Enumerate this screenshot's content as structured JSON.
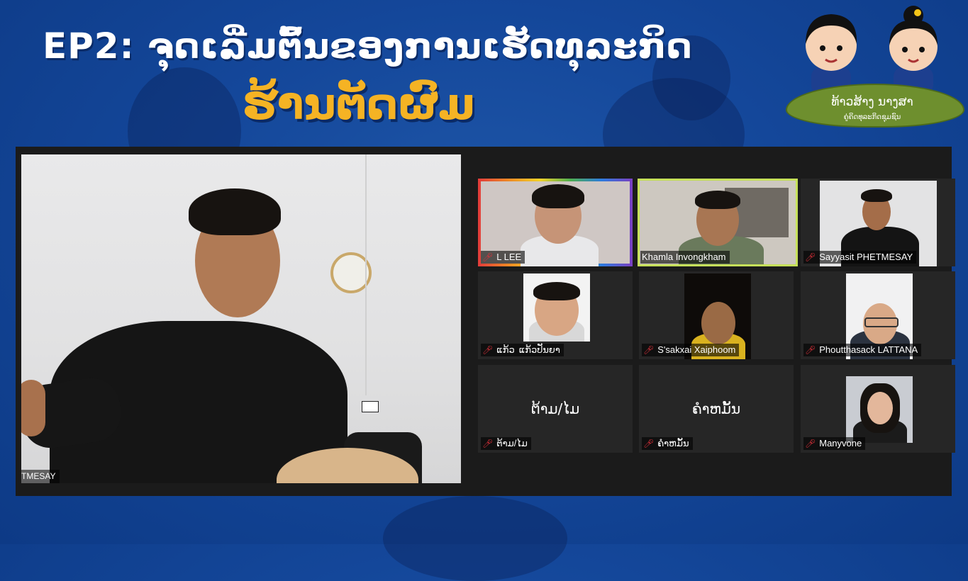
{
  "header": {
    "title": "EP2: ຈຸດເລີ່ມຕົ້ນຂອງການເຮັດທຸລະກິດ",
    "subtitle": "ຮ້ານຕັດຜົມ"
  },
  "logo": {
    "name": "ທ້າວສ້າງ ນາງສາ",
    "tagline": "ຄູ່ຄິດທຸລະກິດຊຸມຊົນ"
  },
  "colors": {
    "accent": "#f5b324",
    "active_speaker": "#c6e05a",
    "muted": "#e0303a"
  },
  "meeting": {
    "active_speaker_name": "TMESAY",
    "participants": [
      {
        "label": "L LEE",
        "muted": true
      },
      {
        "label": "Khamla Invongkham",
        "muted": false,
        "highlighted": true
      },
      {
        "label": "Sayyasit PHETMESAY",
        "muted": true
      },
      {
        "label": "ແກ້ວ",
        "label2": "ແກ້ວປັນຍາ",
        "muted": true
      },
      {
        "label": "S'sakxai Xaiphoom",
        "muted": true
      },
      {
        "label": "Phoutthasack LATTANA",
        "muted": true
      },
      {
        "label": "ຕ້າມ/ໄມ",
        "center_name": "ຕ້າມ/ໄມ",
        "muted": true
      },
      {
        "label": "ຄໍາຫມັ້ນ",
        "center_name": "ຄໍາຫມັ້ນ",
        "muted": true
      },
      {
        "label": "Manyvone",
        "muted": true
      }
    ]
  }
}
